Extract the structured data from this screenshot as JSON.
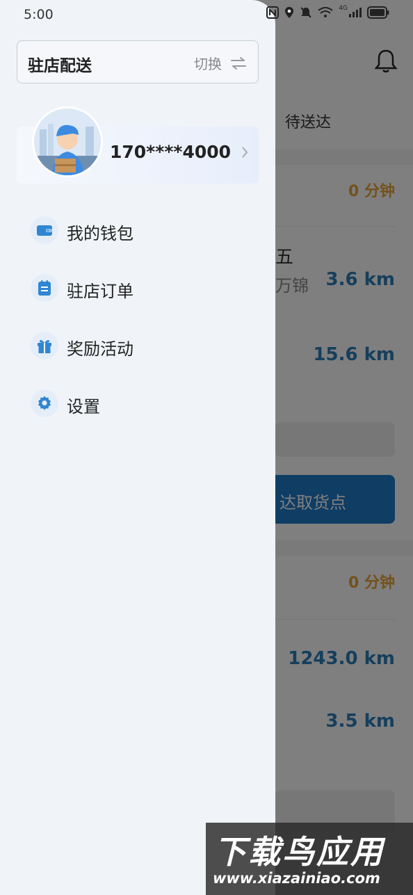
{
  "status_bar": {
    "time": "5:00",
    "network_label": "4G"
  },
  "background": {
    "tab_label": "待送达",
    "orders": [
      {
        "time_left": "0 分钟",
        "partial_name": "五",
        "partial_address": "万锦",
        "distance_1": "3.6 km",
        "distance_2": "15.6 km",
        "button_partial": "达取货点"
      },
      {
        "time_left": "0 分钟",
        "distance_1": "1243.0 km",
        "distance_2": "3.5 km"
      }
    ]
  },
  "drawer": {
    "mode_title": "驻店配送",
    "switch_label": "切换",
    "phone": "170****4000",
    "menu": [
      {
        "label": "我的钱包",
        "icon": "wallet-icon"
      },
      {
        "label": "驻店订单",
        "icon": "clipboard-icon"
      },
      {
        "label": "奖励活动",
        "icon": "gift-icon"
      },
      {
        "label": "设置",
        "icon": "gear-icon"
      }
    ]
  },
  "watermark": {
    "title": "下载鸟应用",
    "url": "www.xiazainiao.com"
  },
  "colors": {
    "accent_blue": "#2c7fb8",
    "orange": "#e8a33a",
    "drawer_bg": "#f0f4f8"
  }
}
